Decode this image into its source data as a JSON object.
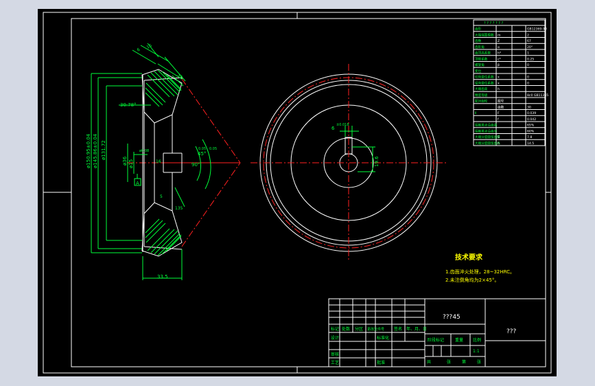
{
  "drawing": {
    "side_view": {
      "dims_vertical": [
        "ø150.95±0.04",
        "ø145.86±0.04",
        "ø131.72",
        "ø36",
        "ø15"
      ],
      "dim_bottom": "33.5",
      "dim_angle_left": "30.78°",
      "dim_angle_cone": "45°",
      "dim_angle_right": "90°",
      "dim_top_a": "6",
      "dim_top_b": "16",
      "dim_top_c": "35",
      "dim_mid": "16",
      "dim_small_a": "0.05",
      "dim_small_b": "ø0.08",
      "dim_right_small": "135",
      "datum": "A",
      "dim_inner": "5",
      "dim_angle_note": "0.05"
    },
    "front_view": {
      "keyway_width": "6",
      "keyway_tol": "±0.018",
      "keyway_depth": "19.6"
    }
  },
  "params_table": {
    "header": "? ? ? ? ? ? ?",
    "rows": [
      {
        "name": "齿形",
        "sym": "",
        "val": "GB12369-90"
      },
      {
        "name": "大端端面模数",
        "sym": "m",
        "val": "2"
      },
      {
        "name": "齿数",
        "sym": "Z",
        "val": "67"
      },
      {
        "name": "齿形角",
        "sym": "α",
        "val": "20°"
      },
      {
        "name": "齿顶高系数",
        "sym": "h*",
        "val": "1"
      },
      {
        "name": "顶隙系数",
        "sym": "c*",
        "val": "0.25"
      },
      {
        "name": "螺旋角",
        "sym": "β",
        "val": "0"
      },
      {
        "name": "变位",
        "sym": "",
        "val": ""
      },
      {
        "name": "切向变位系数",
        "sym": "x",
        "val": "0"
      },
      {
        "name": "径向变位系数",
        "sym": "x",
        "val": "0"
      },
      {
        "name": "大端齿高",
        "sym": "h",
        "val": ""
      },
      {
        "name": "精度等级",
        "sym": "",
        "val": "8c0 GB11365"
      }
    ],
    "rows2": [
      {
        "name": "配对齿轮",
        "sym": "图号",
        "val": ""
      },
      {
        "name": "",
        "sym": "齿数",
        "val": "30"
      },
      {
        "name": "Ⅱ",
        "sym": "F",
        "val": "0.039"
      },
      {
        "name": "",
        "sym": "f",
        "val": "0.042"
      },
      {
        "name": "接触斑点沿齿高",
        "sym": "",
        "val": "65%"
      },
      {
        "name": "接触斑点沿齿长",
        "sym": "",
        "val": "60%"
      },
      {
        "name": "大端分度圆弦齿厚",
        "sym": "S",
        "val": "7.8"
      },
      {
        "name": "大端分度圆弦齿高",
        "sym": "h",
        "val": "14.5"
      }
    ],
    "side_label": "公差组"
  },
  "tech_requirements": {
    "title": "技术要求",
    "items": [
      "1.齿面淬火处理，28~32HRC。",
      "2.未注倒角均为2×45°。"
    ]
  },
  "title_block": {
    "drawing_name": "???45",
    "company": "???",
    "labels": {
      "mark": "标记",
      "count": "处数",
      "zone": "分区",
      "change_doc": "更改文件号",
      "sign": "签名",
      "date": "年、月、日",
      "design": "设计",
      "standard": "标准化",
      "stage": "阶段标记",
      "weight": "重量",
      "scale": "比例",
      "scale_val": "1:1",
      "review": "审核",
      "process": "工艺",
      "approve": "批准",
      "total": "共",
      "sheets": "张",
      "sheet_no": "第",
      "sheet_suffix": "张"
    }
  }
}
